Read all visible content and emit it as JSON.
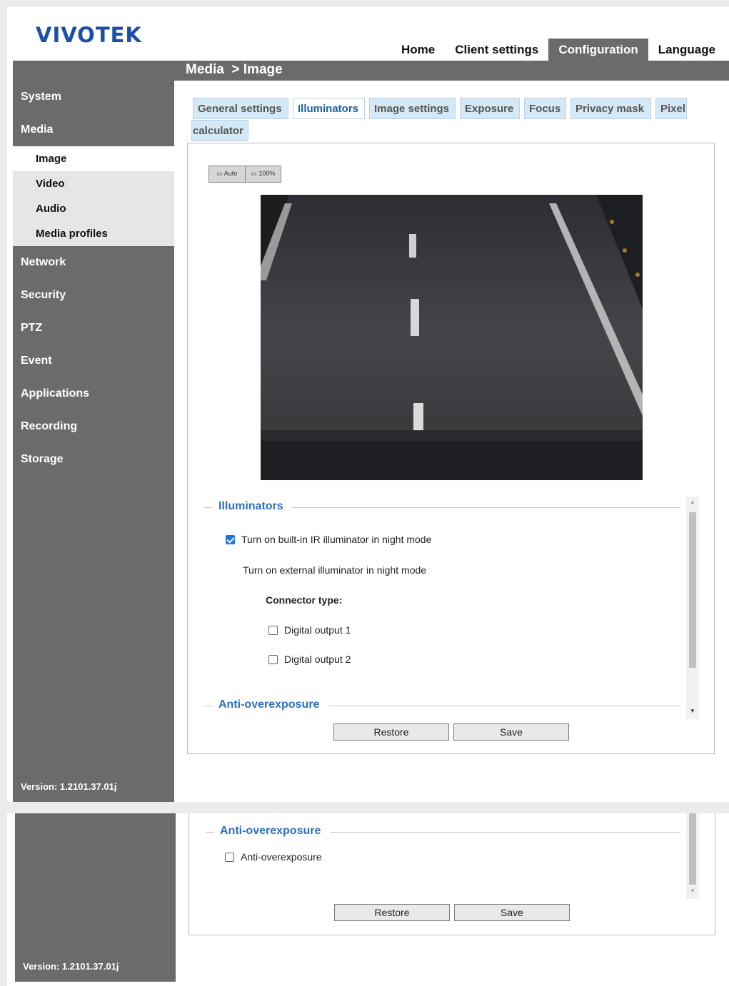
{
  "brand": {
    "logo": "VIVOTEK"
  },
  "top_nav": [
    {
      "label": "Home",
      "active": false
    },
    {
      "label": "Client settings",
      "active": false
    },
    {
      "label": "Configuration",
      "active": true
    },
    {
      "label": "Language",
      "active": false
    }
  ],
  "breadcrumb": "Media  > Image",
  "sidebar": {
    "items_top": [
      "System",
      "Media"
    ],
    "media_sub": [
      "Image",
      "Video",
      "Audio",
      "Media profiles"
    ],
    "items_bottom": [
      "Network",
      "Security",
      "PTZ",
      "Event",
      "Applications",
      "Recording",
      "Storage"
    ],
    "version": "Version: 1.2101.37.01j"
  },
  "tabs": [
    "General settings",
    "Illuminators",
    "Image settings",
    "Exposure",
    "Focus",
    "Privacy mask",
    "Pixel",
    "calculator"
  ],
  "view_buttons": {
    "auto": "Auto",
    "full": "100%"
  },
  "illuminators": {
    "title": "Illuminators",
    "builtin_ir": "Turn on built-in IR illuminator in night mode",
    "builtin_ir_checked": true,
    "external": "Turn on external illuminator in night mode",
    "connector_label": "Connector type:",
    "do1": "Digital output 1",
    "do2": "Digital output 2"
  },
  "anti_overexposure": {
    "title": "Anti-overexposure",
    "option": "Anti-overexposure"
  },
  "buttons": {
    "restore": "Restore",
    "save": "Save"
  },
  "colors": {
    "accent": "#2c6fc2",
    "sidebar": "#6b6b6b",
    "tab_bg": "#d5e8f6",
    "logo": "#1b4fa8"
  }
}
